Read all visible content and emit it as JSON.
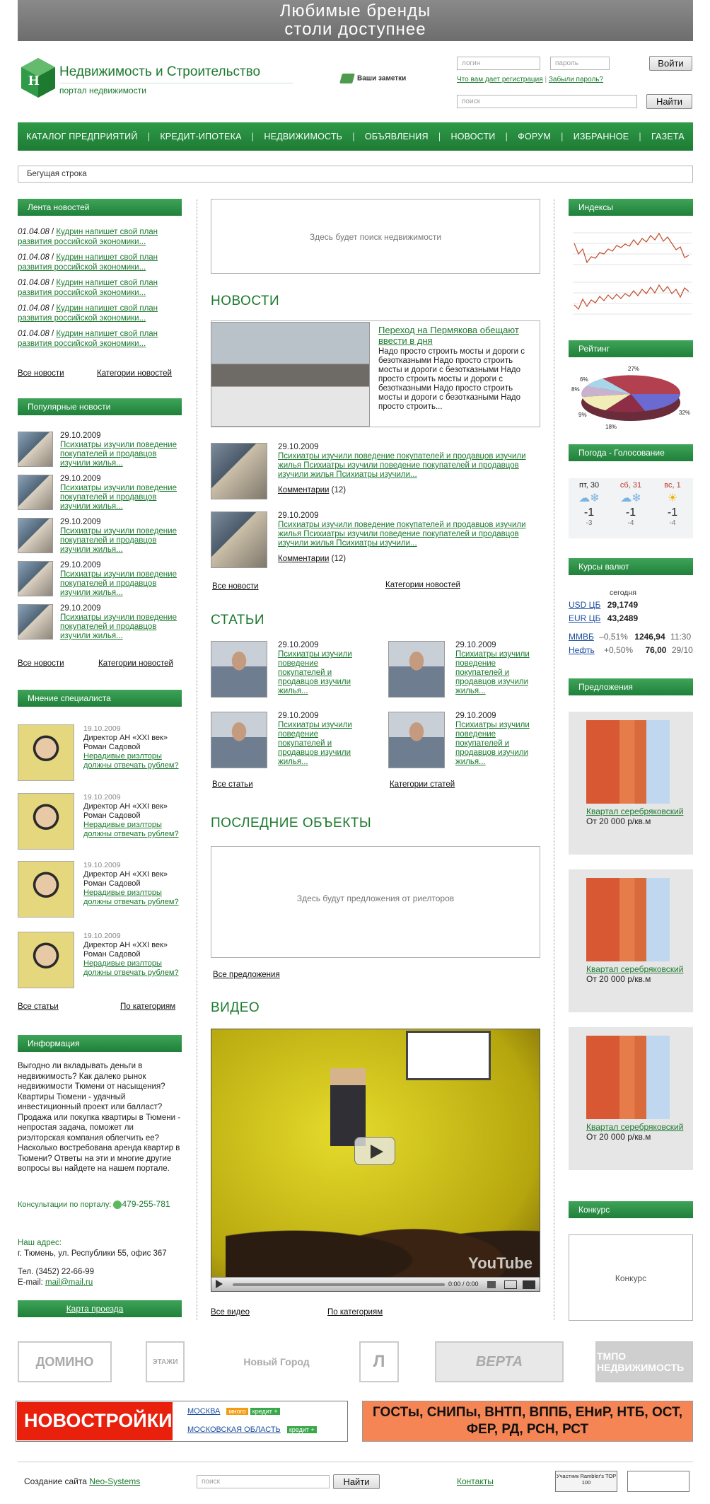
{
  "banner": {
    "line1": "Любимые бренды",
    "line2": "столи доступнее"
  },
  "logo": {
    "title": "Недвижимость и Строительство",
    "subtitle": "портал недвижимости"
  },
  "notes_label": "Ваши заметки",
  "auth": {
    "login_placeholder": "логин",
    "password_placeholder": "пароль",
    "login_button": "Войти",
    "why_register": "Что вам дает регистрация",
    "forgot": "Забыли пароль?",
    "search_placeholder": "поиск",
    "search_button": "Найти"
  },
  "nav": [
    "КАТАЛОГ ПРЕДПРИЯТИЙ",
    "КРЕДИТ-ИПОТЕКА",
    "НЕДВИЖИМОСТЬ",
    "ОБЪЯВЛЕНИЯ",
    "НОВОСТИ",
    "ФОРУМ",
    "ИЗБРАННОЕ",
    "ГАЗЕТА"
  ],
  "ticker": "Бегущая строка",
  "news_feed": {
    "title": "Лента новостей",
    "items": [
      {
        "date": "01.04.08",
        "text": "Кудрин напишет свой план развития российской экономики..."
      },
      {
        "date": "01.04.08",
        "text": "Кудрин напишет свой план развития российской экономики..."
      },
      {
        "date": "01.04.08",
        "text": "Кудрин напишет свой план развития российской экономики..."
      },
      {
        "date": "01.04.08",
        "text": "Кудрин напишет свой план развития российской экономики..."
      },
      {
        "date": "01.04.08",
        "text": "Кудрин напишет свой план развития российской экономики..."
      }
    ],
    "all": "Все новости",
    "categories": "Категории новостей"
  },
  "popular": {
    "title": "Популярные новости",
    "items": [
      {
        "date": "29.10.2009",
        "text": "Психиатры изучили поведение покупателей и продавцов изучили жилья..."
      },
      {
        "date": "29.10.2009",
        "text": "Психиатры изучили поведение покупателей и продавцов изучили жилья..."
      },
      {
        "date": "29.10.2009",
        "text": "Психиатры изучили поведение покупателей и продавцов изучили жилья..."
      },
      {
        "date": "29.10.2009",
        "text": "Психиатры изучили поведение покупателей и продавцов изучили жилья..."
      },
      {
        "date": "29.10.2009",
        "text": "Психиатры изучили поведение покупателей и продавцов изучили жилья..."
      }
    ],
    "all": "Все новости",
    "categories": "Категории новостей"
  },
  "experts": {
    "title": "Мнение специалиста",
    "items": [
      {
        "date": "19.10.2009",
        "role": "Директор АН «XXI век»",
        "name": "Роман Садовой",
        "text": "Нерадивые риэлторы должны отвечать рублем?"
      },
      {
        "date": "19.10.2009",
        "role": "Директор АН «XXI век»",
        "name": "Роман Садовой",
        "text": "Нерадивые риэлторы должны отвечать рублем?"
      },
      {
        "date": "19.10.2009",
        "role": "Директор АН «XXI век»",
        "name": "Роман Садовой",
        "text": "Нерадивые риэлторы должны отвечать рублем?"
      },
      {
        "date": "19.10.2009",
        "role": "Директор АН «XXI век»",
        "name": "Роман Садовой",
        "text": "Нерадивые риэлторы должны отвечать рублем?"
      }
    ],
    "all": "Все статьи",
    "by_cat": "По категориям"
  },
  "info": {
    "title": "Информация",
    "text": "Выгодно ли вкладывать деньги в недвижимость? Как далеко рынок недвижимости Тюмени от насыщения? Квартиры Тюмени - удачный инвестиционный проект или балласт? Продажа или покупка квартиры в Тюмени - непростая задача, поможет ли риэлторская компания облегчить ее? Насколько востребована аренда квартир в Тюмени? Ответы на эти и многие другие вопросы вы найдете на нашем портале.",
    "consult_label": "Консультации по порталу:",
    "phone_icq": "479-255-781",
    "addr_label": "Наш адрес:",
    "addr": "г. Тюмень, ул. Республики 55, офис 367",
    "tel": "Тел. (3452) 22-66-99",
    "email_label": "E-mail:",
    "email": "mail@mail.ru",
    "map": "Карта проезда"
  },
  "center": {
    "search_placeholder_text": "Здесь будет поиск недвижимости",
    "news_title": "НОВОСТИ",
    "lead": {
      "title": "Переход на Пермякова обещают ввести в дня",
      "text": "Надо просто строить мосты и дороги с безотказными Надо просто строить мосты и дороги с безотказными Надо просто строить мосты и дороги с безотказными Надо просто строить мосты и дороги с безотказными Надо просто строить..."
    },
    "news": [
      {
        "date": "29.10.2009",
        "text": "Психиатры изучили поведение покупателей и продавцов изучили жилья Психиатры изучили поведение покупателей и продавцов изучили жилья Психиатры изучили...",
        "comments": "Комментарии",
        "count": "(12)"
      },
      {
        "date": "29.10.2009",
        "text": "Психиатры изучили поведение покупателей и продавцов изучили жилья Психиатры изучили поведение покупателей и продавцов изучили жилья Психиатры изучили...",
        "comments": "Комментарии",
        "count": "(12)"
      }
    ],
    "news_all": "Все новости",
    "news_cat": "Категории новостей",
    "articles_title": "СТАТЬИ",
    "articles": [
      {
        "date": "29.10.2009",
        "text": "Психиатры изучили поведение покупателей и продавцов изучили жилья..."
      },
      {
        "date": "29.10.2009",
        "text": "Психиатры изучили поведение покупателей и продавцов изучили жилья..."
      },
      {
        "date": "29.10.2009",
        "text": "Психиатры изучили поведение покупателей и продавцов изучили жилья..."
      },
      {
        "date": "29.10.2009",
        "text": "Психиатры изучили поведение покупателей и продавцов изучили жилья..."
      }
    ],
    "articles_all": "Все статьи",
    "articles_cat": "Категории статей",
    "objects_title": "ПОСЛЕДНИЕ ОБЪЕКТЫ",
    "objects_placeholder": "Здесь будут предложения от риелторов",
    "objects_all": "Все предложения",
    "video_title": "ВИДЕО",
    "video_time": "0:00 / 0:00",
    "video_brand": "YouTube",
    "video_all": "Все видео",
    "video_cat": "По категориям"
  },
  "right": {
    "indexes": "Индексы",
    "rating": "Рейтинг",
    "pie_labels": [
      "27%",
      "6%",
      "8%",
      "9%",
      "18%",
      "32%"
    ],
    "weather_title": "Погода - Голосование",
    "weather": [
      {
        "day": "пт, 30",
        "temp": "-1",
        "low": "-3",
        "weekend": false
      },
      {
        "day": "сб, 31",
        "temp": "-1",
        "low": "-4",
        "weekend": true
      },
      {
        "day": "вс, 1",
        "temp": "-1",
        "low": "-4",
        "weekend": true
      }
    ],
    "rates_title": "Курсы валют",
    "rates_today": "сегодня",
    "usd_label": "USD ЦБ",
    "usd": "29,1749",
    "eur_label": "EUR ЦБ",
    "eur": "43,2489",
    "micex_label": "ММВБ",
    "micex_chg": "–0,51%",
    "micex_val": "1246,94",
    "micex_time": "11:30",
    "oil_label": "Нефть",
    "oil_chg": "+0,50%",
    "oil_val": "76,00",
    "oil_date": "29/10",
    "offers_title": "Предложения",
    "offers": [
      {
        "name": "Квартал серебряковский",
        "price": "От 20 000 р/кв.м"
      },
      {
        "name": "Квартал серебряковский",
        "price": "От 20 000 р/кв.м"
      },
      {
        "name": "Квартал серебряковский",
        "price": "От 20 000 р/кв.м"
      }
    ],
    "konkurs_title": "Конкурс",
    "konkurs": "Конкурс"
  },
  "partners": [
    "ДОМИНО",
    "ЭТАЖИ",
    "Новый Город",
    "Л",
    "ВЕРТА",
    "ТМПО НЕДВИЖИМОСТЬ"
  ],
  "newbuild": {
    "title": "НОВОСТРОЙКИ",
    "moscow": "МОСКВА",
    "tag1": "много",
    "tag2": "кредит +",
    "region": "МОСКОВСКАЯ ОБЛАСТЬ",
    "tag3": "кредит +"
  },
  "gost": "ГОСТы, СНИПы, ВНТП, ВППБ, ЕНиР, НТБ, ОСТ, ФЕР, РД, РСН, РСТ",
  "footer": {
    "made": "Создание сайта",
    "studio": "Neo-Systems",
    "search_placeholder": "поиск",
    "search_button": "Найти",
    "contacts": "Контакты",
    "rambler": "Участник Rambler's TOP 100"
  },
  "colors": {
    "brand_green": "#1d7a2f",
    "nav_green": "#2e9a48",
    "accent_red": "#e8200c",
    "gost_orange": "#f58554"
  }
}
